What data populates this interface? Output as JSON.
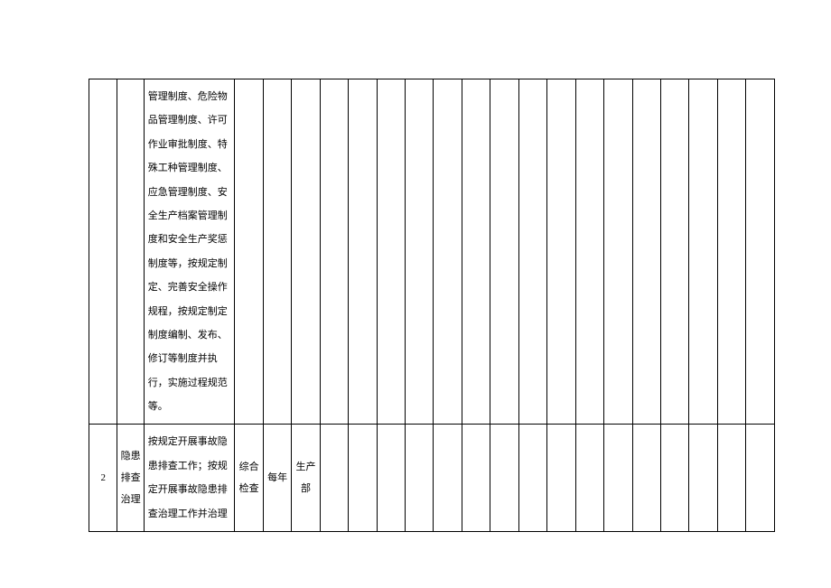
{
  "rows": [
    {
      "index": "",
      "category": "",
      "content": "管理制度、危险物品管理制度、许可作业审批制度、特殊工种管理制度、应急管理制度、安全生产档案管理制度和安全生产奖惩制度等，按规定制定、完善安全操作规程，按规定制定制度编制、发布、修订等制度并执行，实施过程规范等。",
      "col3": "",
      "col4": "",
      "col5": "",
      "col6": "",
      "col7": "",
      "col8": "",
      "col9": "",
      "col10": "",
      "col11": "",
      "col12": "",
      "col13": "",
      "col14": "",
      "col15": "",
      "col16": "",
      "col17": "",
      "col18": "",
      "col19": "",
      "col20": "",
      "col21": ""
    },
    {
      "index": "2",
      "category": "隐患排查治理",
      "content": "按规定开展事故隐患排查工作；按规定开展事故隐患排查治理工作并治理",
      "col3": "综合检查",
      "col4": "每年",
      "col5": "生产部",
      "col6": "",
      "col7": "",
      "col8": "",
      "col9": "",
      "col10": "",
      "col11": "",
      "col12": "",
      "col13": "",
      "col14": "",
      "col15": "",
      "col16": "",
      "col17": "",
      "col18": "",
      "col19": "",
      "col20": "",
      "col21": ""
    }
  ]
}
